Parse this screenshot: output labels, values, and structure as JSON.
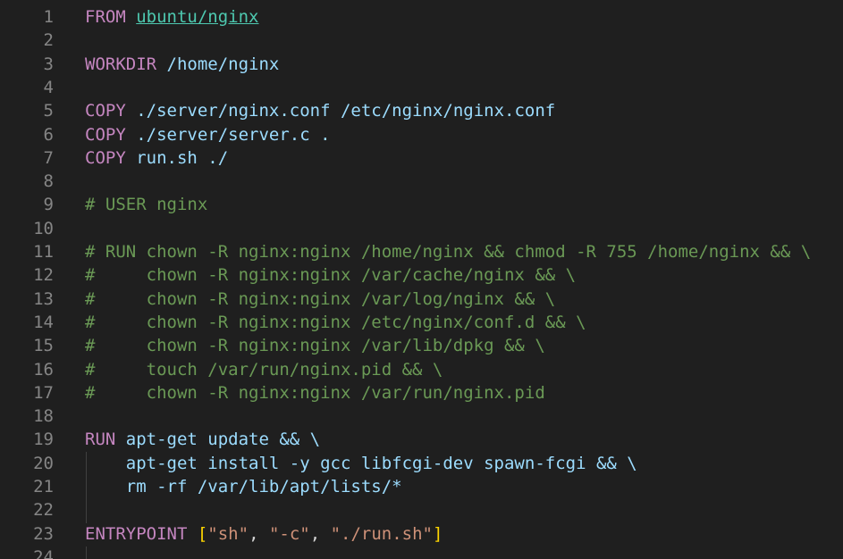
{
  "editor": {
    "lines": [
      {
        "n": "1",
        "segs": [
          {
            "t": "FROM",
            "c": "kw"
          },
          {
            "t": " ",
            "c": "pn"
          },
          {
            "t": "ubuntu/nginx",
            "c": "img"
          }
        ]
      },
      {
        "n": "2",
        "segs": []
      },
      {
        "n": "3",
        "segs": [
          {
            "t": "WORKDIR",
            "c": "kw"
          },
          {
            "t": " /home/nginx",
            "c": "id"
          }
        ]
      },
      {
        "n": "4",
        "segs": []
      },
      {
        "n": "5",
        "segs": [
          {
            "t": "COPY",
            "c": "kw"
          },
          {
            "t": " ./server/nginx.conf /etc/nginx/nginx.conf",
            "c": "id"
          }
        ]
      },
      {
        "n": "6",
        "segs": [
          {
            "t": "COPY",
            "c": "kw"
          },
          {
            "t": " ./server/server.c .",
            "c": "id"
          }
        ]
      },
      {
        "n": "7",
        "segs": [
          {
            "t": "COPY",
            "c": "kw"
          },
          {
            "t": " run.sh ./",
            "c": "id"
          }
        ]
      },
      {
        "n": "8",
        "segs": []
      },
      {
        "n": "9",
        "segs": [
          {
            "t": "# USER nginx",
            "c": "cm"
          }
        ]
      },
      {
        "n": "10",
        "segs": []
      },
      {
        "n": "11",
        "segs": [
          {
            "t": "# RUN chown -R nginx:nginx /home/nginx && chmod -R 755 /home/nginx && \\",
            "c": "cm"
          }
        ]
      },
      {
        "n": "12",
        "segs": [
          {
            "t": "#     chown -R nginx:nginx /var/cache/nginx && \\",
            "c": "cm"
          }
        ]
      },
      {
        "n": "13",
        "segs": [
          {
            "t": "#     chown -R nginx:nginx /var/log/nginx && \\",
            "c": "cm"
          }
        ]
      },
      {
        "n": "14",
        "segs": [
          {
            "t": "#     chown -R nginx:nginx /etc/nginx/conf.d && \\",
            "c": "cm"
          }
        ]
      },
      {
        "n": "15",
        "segs": [
          {
            "t": "#     chown -R nginx:nginx /var/lib/dpkg && \\",
            "c": "cm"
          }
        ]
      },
      {
        "n": "16",
        "segs": [
          {
            "t": "#     touch /var/run/nginx.pid && \\",
            "c": "cm"
          }
        ]
      },
      {
        "n": "17",
        "segs": [
          {
            "t": "#     chown -R nginx:nginx /var/run/nginx.pid",
            "c": "cm"
          }
        ]
      },
      {
        "n": "18",
        "segs": []
      },
      {
        "n": "19",
        "segs": [
          {
            "t": "RUN",
            "c": "kw"
          },
          {
            "t": " apt-get update && \\",
            "c": "id"
          }
        ]
      },
      {
        "n": "20",
        "segs": [
          {
            "t": "    apt-get install -y gcc libfcgi-dev spawn-fcgi && \\",
            "c": "id"
          }
        ]
      },
      {
        "n": "21",
        "segs": [
          {
            "t": "    rm -rf /var/lib/apt/lists/*",
            "c": "id"
          }
        ]
      },
      {
        "n": "22",
        "segs": []
      },
      {
        "n": "23",
        "segs": [
          {
            "t": "ENTRYPOINT",
            "c": "kw"
          },
          {
            "t": " ",
            "c": "pn"
          },
          {
            "t": "[",
            "c": "br"
          },
          {
            "t": "\"sh\"",
            "c": "str"
          },
          {
            "t": ", ",
            "c": "pn"
          },
          {
            "t": "\"-c\"",
            "c": "str"
          },
          {
            "t": ", ",
            "c": "pn"
          },
          {
            "t": "\"./run.sh\"",
            "c": "str"
          },
          {
            "t": "]",
            "c": "br"
          }
        ]
      },
      {
        "n": "24",
        "segs": []
      }
    ]
  },
  "colors": {
    "background": "#1f1f1f",
    "line_number": "#858585",
    "keyword": "#c586c0",
    "identifier": "#9cdcfe",
    "image_link": "#4ec9b0",
    "comment": "#6a9955",
    "string": "#ce9178",
    "bracket": "#ffd700"
  }
}
